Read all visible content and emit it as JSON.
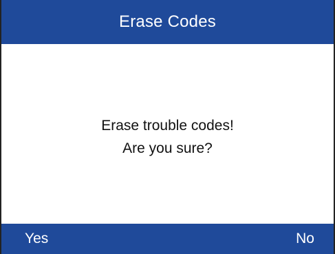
{
  "screen": {
    "title": "Erase Codes",
    "message_line1": "Erase trouble codes!",
    "message_line2": "Are you sure?"
  },
  "softkeys": {
    "yes_label": "Yes",
    "no_label": "No"
  },
  "colors": {
    "bar": "#1f4a9a",
    "bar_text": "#ffffff",
    "body_bg": "#ffffff",
    "body_text": "#111111"
  }
}
